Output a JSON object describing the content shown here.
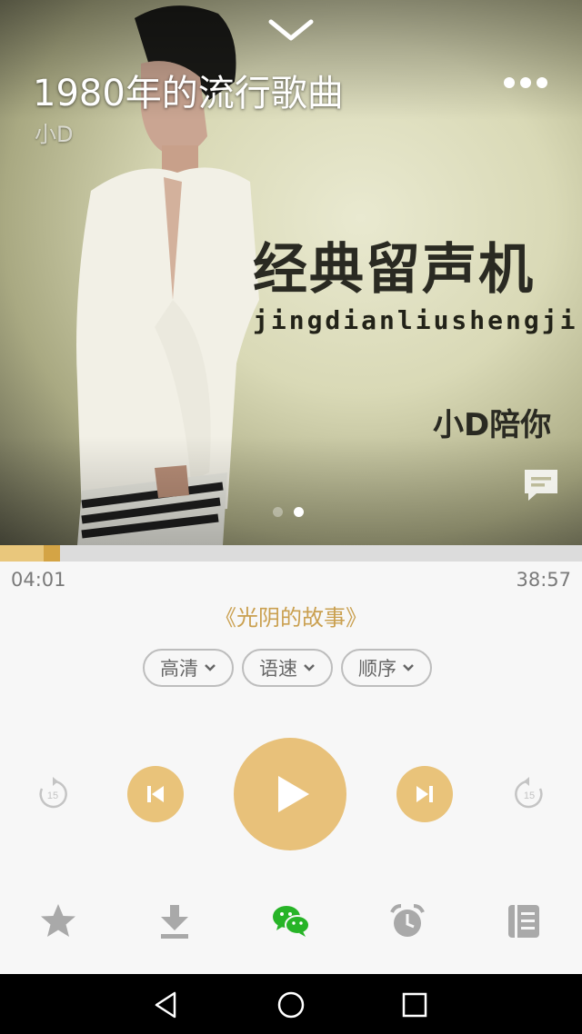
{
  "header": {
    "title": "1980年的流行歌曲",
    "artist": "小D"
  },
  "cover": {
    "title_cn": "经典留声机",
    "title_pinyin": "jingdianliushengji",
    "byline": "小D陪你",
    "page_indicator": {
      "count": 2,
      "active_index": 1
    }
  },
  "player": {
    "current_time": "04:01",
    "total_time": "38:57",
    "progress_fraction": 0.103,
    "buffered_fraction": 0.09,
    "track_title": "《光阴的故事》",
    "options": [
      {
        "label": "高清"
      },
      {
        "label": "语速"
      },
      {
        "label": "顺序"
      }
    ],
    "rewind_seconds": "15",
    "forward_seconds": "15"
  },
  "colors": {
    "accent": "#e8c17a",
    "accent_dark": "#d4a445",
    "track_title": "#caa050",
    "wechat_green": "#27b427",
    "icon_gray": "#a9a9a9"
  },
  "icons": {
    "collapse": "chevron-down-icon",
    "more": "more-dots-icon",
    "comment": "comment-icon",
    "bottom": [
      "star-icon",
      "download-icon",
      "wechat-icon",
      "alarm-icon",
      "playlist-icon"
    ],
    "nav": [
      "back-icon",
      "home-icon",
      "recents-icon"
    ]
  }
}
